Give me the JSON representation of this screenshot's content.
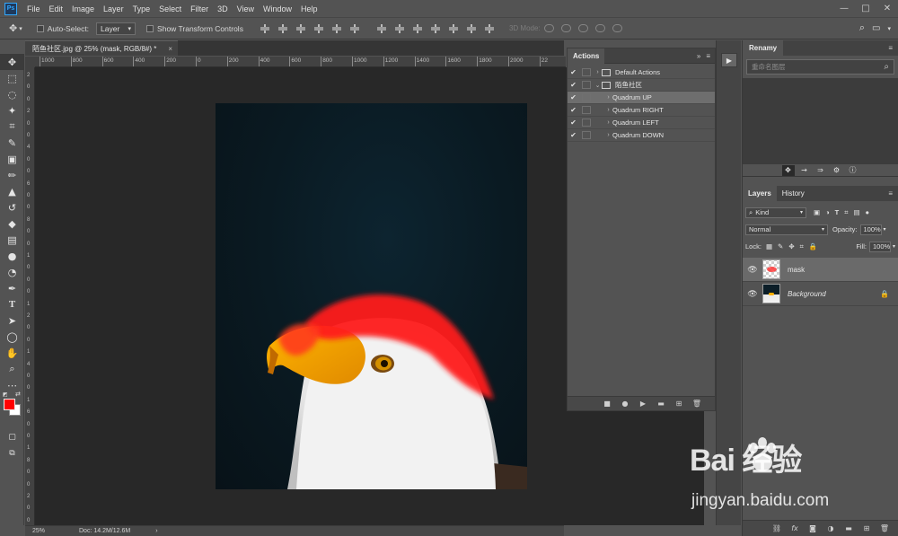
{
  "app": {
    "logo": "Ps"
  },
  "menu": [
    "File",
    "Edit",
    "Image",
    "Layer",
    "Type",
    "Select",
    "Filter",
    "3D",
    "View",
    "Window",
    "Help"
  ],
  "window_controls": [
    "—",
    "□",
    "✕"
  ],
  "options": {
    "auto_select_label": "Auto-Select:",
    "auto_select_target": "Layer",
    "transform_label": "Show Transform Controls",
    "mode_3d_label": "3D Mode:"
  },
  "document": {
    "tab_title": "陌鱼社区.jpg @ 25% (mask, RGB/8#) *",
    "close_glyph": "×",
    "zoom": "25%",
    "doc_info": "Doc: 14.2M/12.6M"
  },
  "ruler_h_labels": [
    "1000",
    "800",
    "600",
    "400",
    "200",
    "0",
    "200",
    "400",
    "600",
    "800",
    "1000",
    "1200",
    "1400",
    "1600",
    "1800",
    "2000",
    "22"
  ],
  "ruler_v_labels": [
    "2",
    "0",
    "0",
    "2",
    "0",
    "0",
    "4",
    "0",
    "0",
    "6",
    "0",
    "0",
    "8",
    "0",
    "0",
    "1",
    "0",
    "0",
    "0",
    "1",
    "2",
    "0",
    "0",
    "1",
    "4",
    "0",
    "0",
    "1",
    "6",
    "0",
    "0",
    "1",
    "8",
    "0",
    "0",
    "2",
    "0",
    "0"
  ],
  "actions": {
    "tab": "Actions",
    "rows": [
      {
        "label": "Default Actions",
        "type": "set",
        "arrow": "›"
      },
      {
        "label": "陌鱼社区",
        "type": "set",
        "arrow": "⌄"
      },
      {
        "label": "Quadrum UP",
        "type": "action",
        "arrow": "›",
        "selected": true
      },
      {
        "label": "Quadrum RIGHT",
        "type": "action",
        "arrow": "›"
      },
      {
        "label": "Quadrum LEFT",
        "type": "action",
        "arrow": "›"
      },
      {
        "label": "Quadrum DOWN",
        "type": "action",
        "arrow": "›"
      }
    ]
  },
  "renamy": {
    "tab": "Renamy",
    "search_placeholder": "重命名图层"
  },
  "layers": {
    "tabs": [
      "Layers",
      "History"
    ],
    "filter_kind": "Kind",
    "blend_mode": "Normal",
    "opacity_label": "Opacity:",
    "opacity_value": "100%",
    "lock_label": "Lock:",
    "fill_label": "Fill:",
    "fill_value": "100%",
    "items": [
      {
        "name": "mask",
        "selected": true,
        "locked": false
      },
      {
        "name": "Background",
        "selected": false,
        "locked": true
      }
    ]
  },
  "watermark": {
    "brand": "Bai  经验",
    "url": "jingyan.baidu.com"
  },
  "colors": {
    "foreground": "#ff0000",
    "background": "#ffffff",
    "accent": "#31a8ff"
  }
}
